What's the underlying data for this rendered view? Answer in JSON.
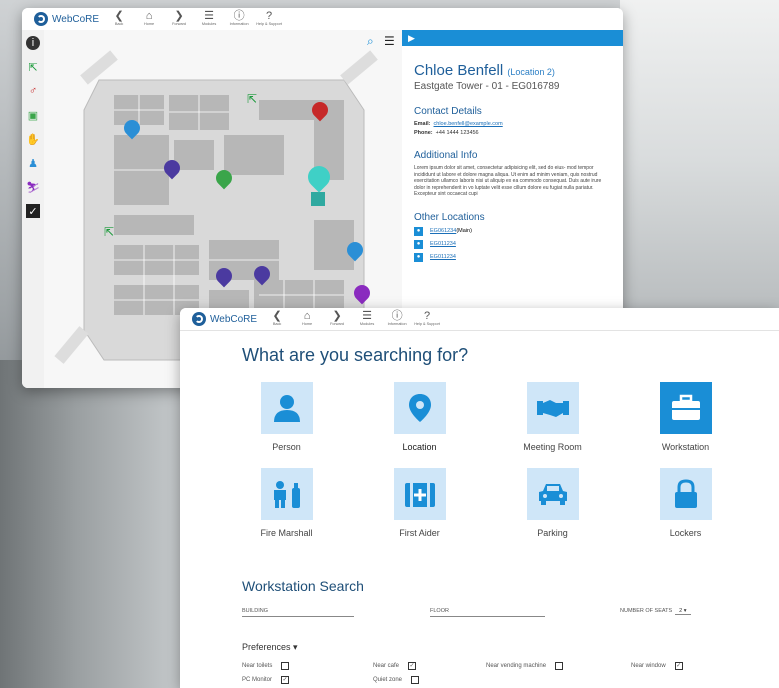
{
  "app": {
    "name": "WebCoRE"
  },
  "nav": [
    {
      "label": "Back",
      "glyph": "❮"
    },
    {
      "label": "Home",
      "glyph": "⌂"
    },
    {
      "label": "Forward",
      "glyph": "❯"
    },
    {
      "label": "Modules",
      "glyph": "☰"
    },
    {
      "label": "Information",
      "glyph": "ⓘ"
    },
    {
      "label": "Help & Support",
      "glyph": "?"
    }
  ],
  "detail": {
    "name": "Chloe Benfell",
    "location_tag": "(Location 2)",
    "subtitle": "Eastgate Tower - 01 - EG016789",
    "contact_heading": "Contact Details",
    "email_label": "Email:",
    "email": "chloe.benfell@example.com",
    "phone_label": "Phone:",
    "phone": "+44 1444 123456",
    "info_heading": "Additional Info",
    "info_text": "Lorem ipsum dolor sit amet, consectetur adipisicing elit, sed do eius- mod tempor incididunt ut labore et dolore magna aliqua. Ut enim ad minim veniam, quis nostrud exercitation ullamco laboris nisi ut aliquip ex ea commodo consequat. Duis aute irure dolor in reprehenderit in vo luptate velit esse cillum dolore eu fugiat nulla pariatur. Excepteur sint occaecat cupi",
    "other_heading": "Other Locations",
    "locations": [
      {
        "code": "EG061234",
        "suffix": "(Main)"
      },
      {
        "code": "EG011234",
        "suffix": ""
      },
      {
        "code": "EG011234",
        "suffix": ""
      }
    ]
  },
  "search": {
    "title": "What are you searching for?",
    "tiles": [
      {
        "label": "Person"
      },
      {
        "label": "Location"
      },
      {
        "label": "Meeting Room"
      },
      {
        "label": "Workstation"
      },
      {
        "label": "Fire Marshall"
      },
      {
        "label": "First Aider"
      },
      {
        "label": "Parking"
      },
      {
        "label": "Lockers"
      }
    ],
    "ws_title": "Workstation Search",
    "building": "BUILDING",
    "floor": "FLOOR",
    "seats_label": "NUMBER OF SEATS",
    "seats_value": "2 ▾",
    "preferences": "Preferences ▾",
    "options": [
      {
        "label": "Near toilets",
        "checked": false
      },
      {
        "label": "Near cafe",
        "checked": true
      },
      {
        "label": "Near vending machine",
        "checked": false
      },
      {
        "label": "Near window",
        "checked": true
      },
      {
        "label": "PC Monitor",
        "checked": true
      },
      {
        "label": "Quiet zone",
        "checked": false
      }
    ]
  },
  "colors": {
    "accent": "#1a8ed6",
    "title": "#1f4f78"
  }
}
